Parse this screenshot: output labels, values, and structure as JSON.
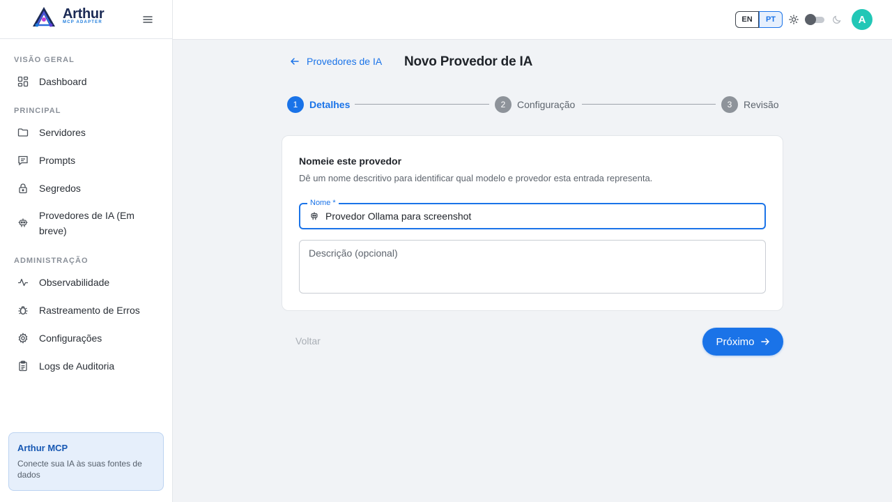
{
  "brand": {
    "name": "Arthur",
    "subtitle": "MCP ADAPTER"
  },
  "sidebar": {
    "sections": [
      {
        "label": "VISÃO GERAL"
      },
      {
        "label": "PRINCIPAL"
      },
      {
        "label": "ADMINISTRAÇÃO"
      }
    ],
    "items": [
      {
        "label": "Dashboard",
        "icon": "dashboard-icon"
      },
      {
        "label": "Servidores",
        "icon": "folder-icon"
      },
      {
        "label": "Prompts",
        "icon": "message-icon"
      },
      {
        "label": "Segredos",
        "icon": "lock-icon"
      },
      {
        "label": "Provedores de IA (Em breve)",
        "icon": "robot-icon"
      },
      {
        "label": "Observabilidade",
        "icon": "activity-icon"
      },
      {
        "label": "Rastreamento de Erros",
        "icon": "bug-icon"
      },
      {
        "label": "Configurações",
        "icon": "gear-icon"
      },
      {
        "label": "Logs de Auditoria",
        "icon": "clipboard-icon"
      }
    ],
    "promo": {
      "title": "Arthur MCP",
      "text": "Conecte sua IA às suas fontes de dados"
    }
  },
  "topbar": {
    "languages": [
      "EN",
      "PT"
    ],
    "active_language": "PT",
    "avatar_initial": "A"
  },
  "page": {
    "back_label": "Provedores de IA",
    "title": "Novo Provedor de IA"
  },
  "stepper": {
    "steps": [
      {
        "number": "1",
        "label": "Detalhes",
        "active": true
      },
      {
        "number": "2",
        "label": "Configuração",
        "active": false
      },
      {
        "number": "3",
        "label": "Revisão",
        "active": false
      }
    ]
  },
  "form": {
    "title": "Nomeie este provedor",
    "description": "Dê um nome descritivo para identificar qual modelo e provedor esta entrada representa.",
    "name_label": "Nome *",
    "name_value": "Provedor Ollama para screenshot",
    "description_placeholder": "Descrição (opcional)",
    "description_value": ""
  },
  "actions": {
    "back_label": "Voltar",
    "next_label": "Próximo"
  },
  "colors": {
    "accent": "#1a73e8",
    "avatar": "#22c7b6",
    "brand": "#1b2a55"
  }
}
